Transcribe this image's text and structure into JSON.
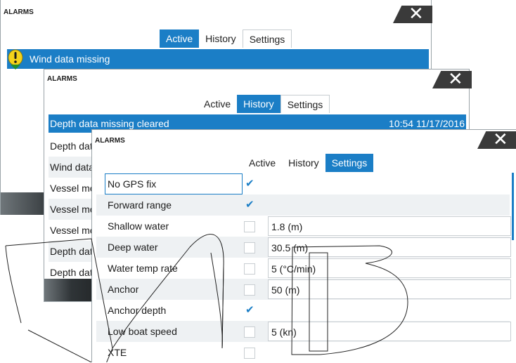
{
  "dialog1": {
    "title": "ALARMS",
    "tabs": [
      "Active",
      "History",
      "Settings"
    ],
    "selected_row": "Wind data missing",
    "icon": "warning-icon"
  },
  "dialog2": {
    "title": "ALARMS",
    "tabs": [
      "Active",
      "History",
      "Settings"
    ],
    "rows": [
      {
        "text": "Depth data missing cleared",
        "time": "10:54 11/17/2016"
      },
      {
        "text": "Depth data"
      },
      {
        "text": "Wind data"
      },
      {
        "text": "Vessel mes"
      },
      {
        "text": "Vessel mes"
      },
      {
        "text": "Vessel mes"
      },
      {
        "text": "Depth data"
      },
      {
        "text": "Depth data"
      }
    ]
  },
  "dialog3": {
    "title": "ALARMS",
    "tabs": [
      "Active",
      "History",
      "Settings"
    ],
    "settings": [
      {
        "name": "No GPS fix",
        "checked": true,
        "value": ""
      },
      {
        "name": "Forward range",
        "checked": true,
        "value": ""
      },
      {
        "name": "Shallow water",
        "checked": false,
        "value": "1.8 (m)"
      },
      {
        "name": "Deep water",
        "checked": false,
        "value": "30.5 (m)"
      },
      {
        "name": "Water temp rate",
        "checked": false,
        "value": "5 (°C/min)"
      },
      {
        "name": "Anchor",
        "checked": false,
        "value": "50 (m)"
      },
      {
        "name": "Anchor depth",
        "checked": true,
        "value": ""
      },
      {
        "name": "Low boat speed",
        "checked": false,
        "value": "5 (kn)"
      },
      {
        "name": "XTE",
        "checked": false,
        "value": ""
      }
    ]
  },
  "colors": {
    "accent": "#1b7ec6",
    "close_tab": "#3a3a3a",
    "alt_row": "#eef1f3"
  },
  "close_label": "✕"
}
